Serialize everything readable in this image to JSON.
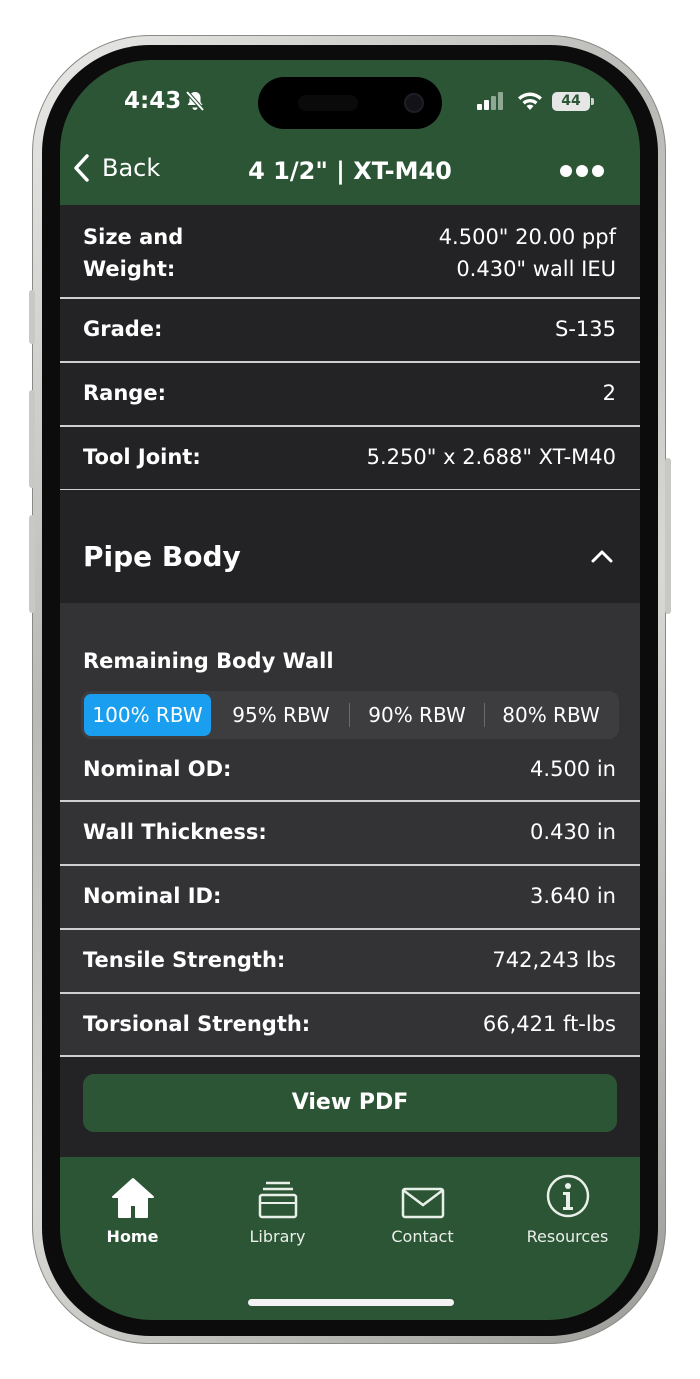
{
  "status_bar": {
    "time": "4:43",
    "battery": "44"
  },
  "nav": {
    "back_label": "Back",
    "title": "4 1/2\" | XT-M40"
  },
  "specs": [
    {
      "label_line1": "Size and",
      "label_line2": "Weight:",
      "value_line1": "4.500\" 20.00 ppf",
      "value_line2": "0.430\" wall IEU"
    },
    {
      "label": "Grade:",
      "value": "S-135"
    },
    {
      "label": "Range:",
      "value": "2"
    },
    {
      "label": "Tool Joint:",
      "value": "5.250\" x 2.688\" XT-M40"
    }
  ],
  "pipe_body": {
    "title": "Pipe Body",
    "rbw_title": "Remaining Body Wall",
    "rbw_options": [
      "100% RBW",
      "95% RBW",
      "90% RBW",
      "80% RBW"
    ],
    "rbw_selected": "100% RBW",
    "rows": [
      {
        "label": "Nominal OD:",
        "value": "4.500 in"
      },
      {
        "label": "Wall Thickness:",
        "value": "0.430 in"
      },
      {
        "label": "Nominal ID:",
        "value": "3.640 in"
      },
      {
        "label": "Tensile Strength:",
        "value": "742,243 lbs"
      },
      {
        "label": "Torsional Strength:",
        "value": "66,421 ft-lbs"
      }
    ]
  },
  "pdf_button": "View PDF",
  "tabs": [
    {
      "label": "Home",
      "icon": "home-icon",
      "active": true
    },
    {
      "label": "Library",
      "icon": "library-icon",
      "active": false
    },
    {
      "label": "Contact",
      "icon": "envelope-icon",
      "active": false
    },
    {
      "label": "Resources",
      "icon": "info-icon",
      "active": false
    }
  ],
  "colors": {
    "brand_green": "#2c5535",
    "accent_blue": "#1a9ef0",
    "row_dark": "#232325",
    "row_light": "#333335"
  }
}
